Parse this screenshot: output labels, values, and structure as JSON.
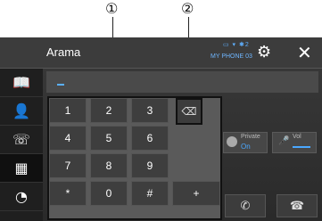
{
  "callouts": {
    "one": "①",
    "two": "②"
  },
  "header": {
    "title": "Arama",
    "status_icons": "▭ ▾ ✱2",
    "device_name": "MY PHONE 03",
    "settings_icon": "⚙",
    "close_icon": "✕"
  },
  "sidebar": {
    "items": [
      {
        "name": "phonebook-icon",
        "glyph": "📖"
      },
      {
        "name": "contact-icon",
        "glyph": "👤"
      },
      {
        "name": "call-history-icon",
        "glyph": "☏"
      },
      {
        "name": "keypad-icon",
        "glyph": "▦"
      },
      {
        "name": "voice-icon",
        "glyph": "◔"
      }
    ],
    "active_index": 3
  },
  "input": {
    "value": ""
  },
  "keypad": {
    "keys": [
      "1",
      "2",
      "3",
      "4",
      "5",
      "6",
      "7",
      "8",
      "9",
      "*",
      "0",
      "#",
      "+"
    ]
  },
  "backspace": {
    "glyph": "⌫"
  },
  "private": {
    "label": "Private",
    "value": "On"
  },
  "volume": {
    "label": "Vol"
  },
  "buttons": {
    "call_glyph": "✆",
    "end_glyph": "☎"
  },
  "colors": {
    "accent": "#4aa8ff",
    "background": "#2e2e2e",
    "key": "#3e3e3e"
  }
}
